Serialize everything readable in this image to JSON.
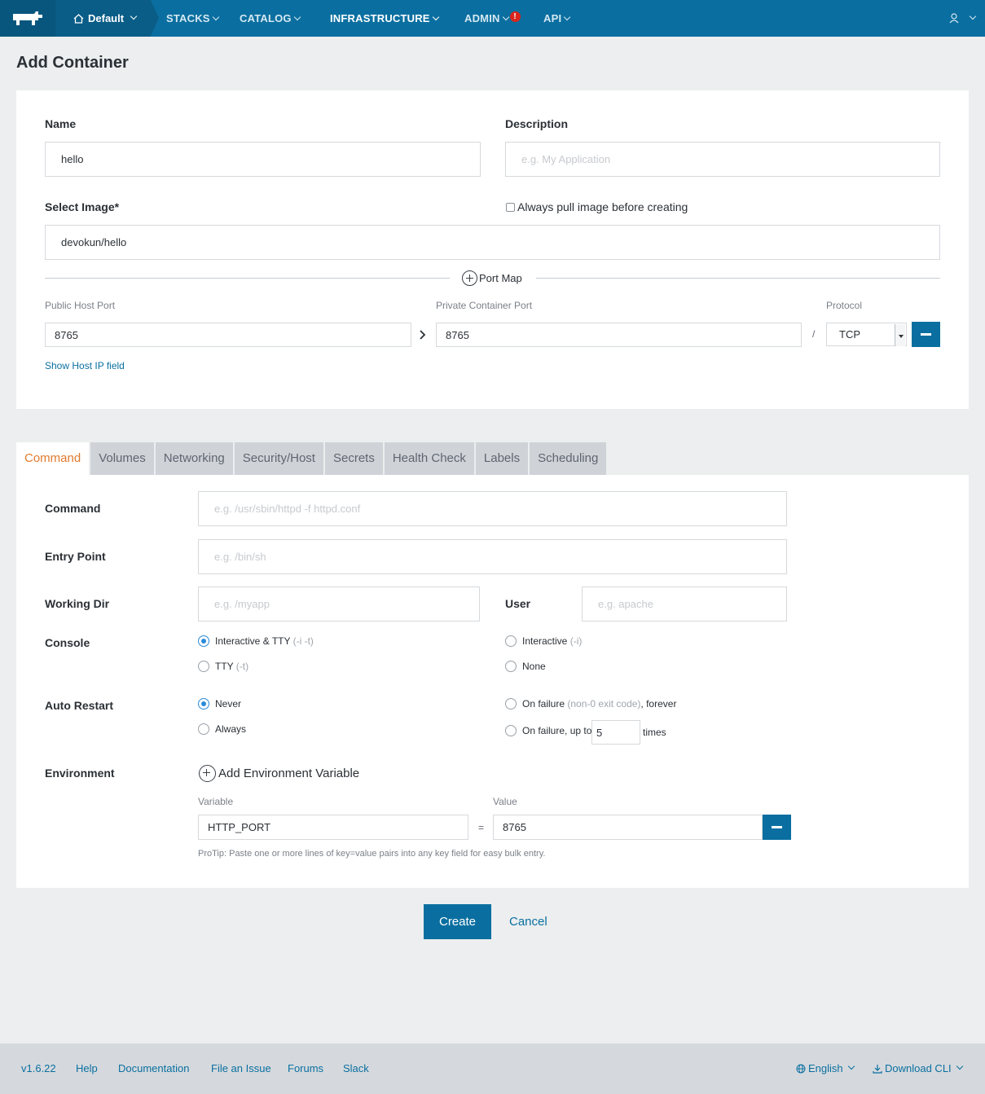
{
  "nav": {
    "environment": "Default",
    "items": [
      "STACKS",
      "CATALOG",
      "INFRASTRUCTURE",
      "ADMIN",
      "API"
    ],
    "admin_alert": "!"
  },
  "page": {
    "title": "Add Container"
  },
  "form": {
    "name_label": "Name",
    "name_value": "hello",
    "description_label": "Description",
    "description_placeholder": "e.g. My Application",
    "image_label": "Select Image*",
    "image_value": "devokun/hello",
    "always_pull_label": "Always pull image before creating",
    "port_map_label": "Port Map",
    "public_port_label": "Public Host Port",
    "public_port_value": "8765",
    "private_port_label": "Private Container Port",
    "private_port_value": "8765",
    "slash": "/",
    "protocol_label": "Protocol",
    "protocol_value": "TCP",
    "show_host_ip": "Show Host IP field"
  },
  "tabs": [
    "Command",
    "Volumes",
    "Networking",
    "Security/Host",
    "Secrets",
    "Health Check",
    "Labels",
    "Scheduling"
  ],
  "command_tab": {
    "command_label": "Command",
    "command_placeholder": "e.g. /usr/sbin/httpd -f httpd.conf",
    "entry_label": "Entry Point",
    "entry_placeholder": "e.g. /bin/sh",
    "workdir_label": "Working Dir",
    "workdir_placeholder": "e.g. /myapp",
    "user_label": "User",
    "user_placeholder": "e.g. apache",
    "console_label": "Console",
    "console_options": [
      {
        "text": "Interactive & TTY",
        "hint": "(-i -t)",
        "selected": true
      },
      {
        "text": "Interactive",
        "hint": "(-i)",
        "selected": false
      },
      {
        "text": "TTY",
        "hint": "(-t)",
        "selected": false
      },
      {
        "text": "None",
        "hint": "",
        "selected": false
      }
    ],
    "restart_label": "Auto Restart",
    "restart_never": "Never",
    "restart_failure_forever_a": "On failure",
    "restart_failure_forever_hint": "(non-0 exit code)",
    "restart_failure_forever_b": ", forever",
    "restart_always": "Always",
    "restart_failure_upto": "On failure, up to",
    "restart_count": "5",
    "restart_times": "times",
    "env_label": "Environment",
    "add_env": "Add Environment Variable",
    "variable_label": "Variable",
    "value_label": "Value",
    "env_variable": "HTTP_PORT",
    "env_equals": "=",
    "env_value": "8765",
    "protip": "ProTip: Paste one or more lines of key=value pairs into any key field for easy bulk entry."
  },
  "actions": {
    "create": "Create",
    "cancel": "Cancel"
  },
  "footer": {
    "version": "v1.6.22",
    "help": "Help",
    "documentation": "Documentation",
    "file_issue": "File an Issue",
    "forums": "Forums",
    "slack": "Slack",
    "language": "English",
    "download": "Download CLI"
  },
  "colors": {
    "primary": "#0a6fa0",
    "active_tab": "#e07a2e",
    "alert": "#d9251c"
  }
}
